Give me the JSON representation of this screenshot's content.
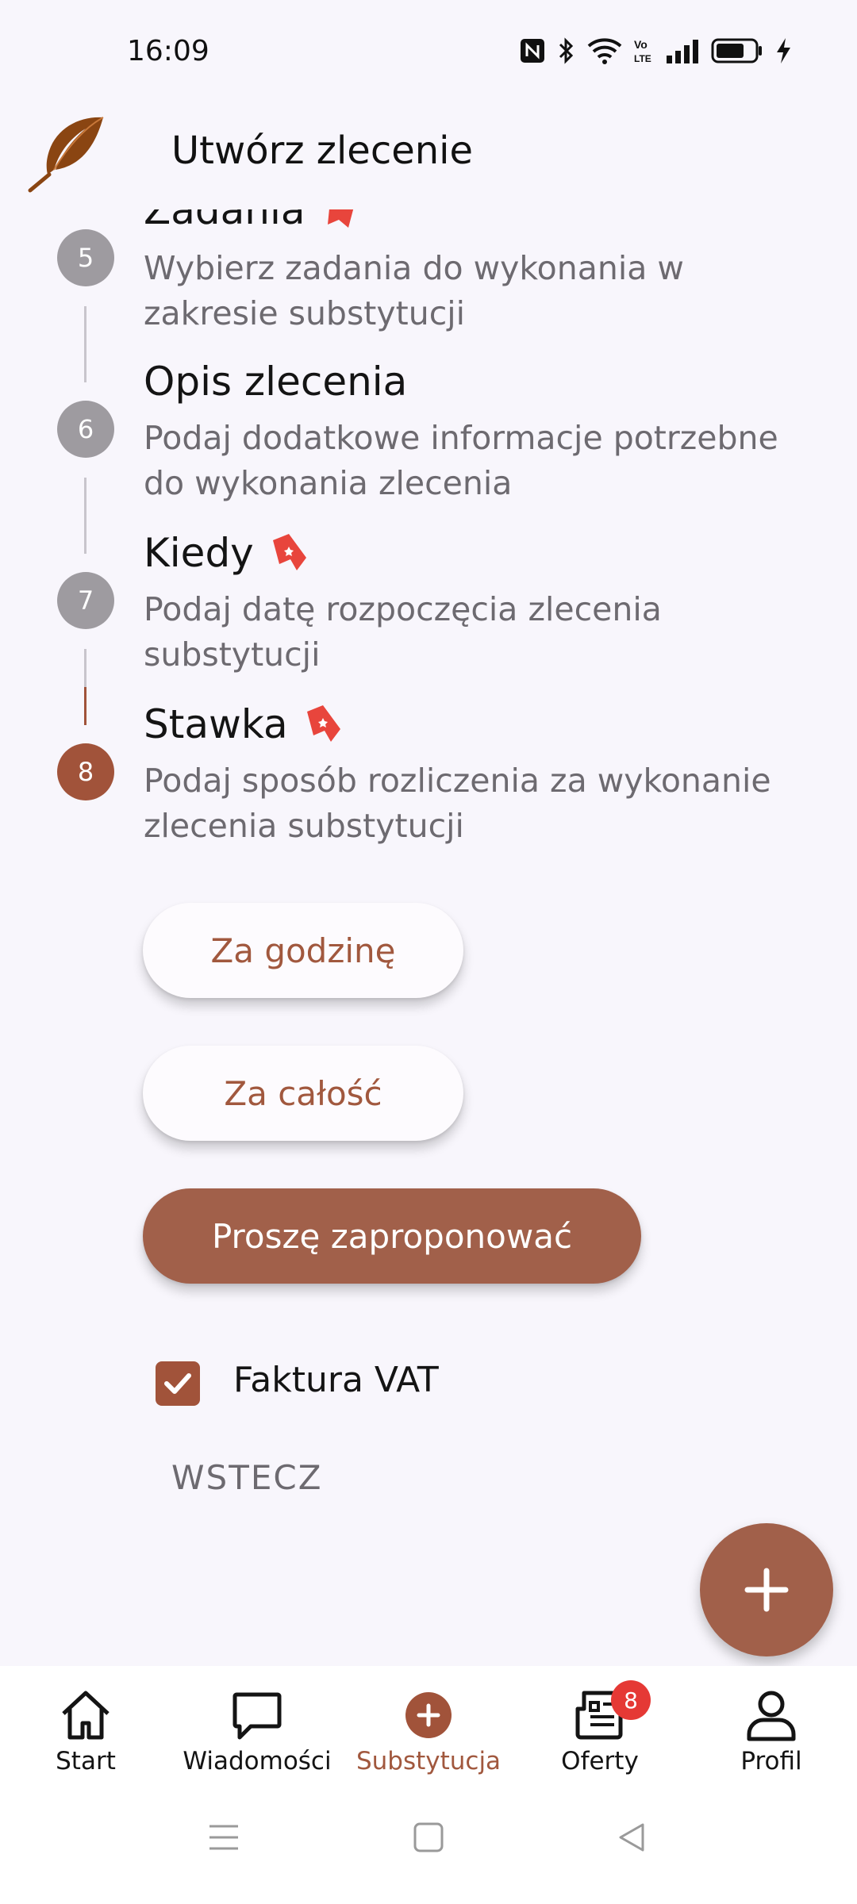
{
  "status_bar": {
    "time": "16:09",
    "icons": [
      "nfc-icon",
      "bluetooth-icon",
      "wifi-icon",
      "volte-icon",
      "signal-icon",
      "battery-icon",
      "charging-icon"
    ]
  },
  "app_bar": {
    "title": "Utwórz zlecenie",
    "logo": "feather-icon"
  },
  "steps": [
    {
      "number": "5",
      "title": "Zadania",
      "description": "Wybierz zadania do wykonania w zakresie substytucji",
      "required": true
    },
    {
      "number": "6",
      "title": "Opis zlecenia",
      "description": "Podaj dodatkowe informacje potrzebne do wykonania zlecenia",
      "required": false
    },
    {
      "number": "7",
      "title": "Kiedy",
      "description": "Podaj datę rozpoczęcia zlecenia substytucji",
      "required": true
    },
    {
      "number": "8",
      "title": "Stawka",
      "description": "Podaj sposób rozliczenia za wykonanie zlecenia substytucji",
      "required": true,
      "active": true
    }
  ],
  "rate_options": {
    "hourly": "Za godzinę",
    "total": "Za całość",
    "propose": "Proszę zaproponować",
    "selected": "Proszę zaproponować"
  },
  "vat_checkbox": {
    "label": "Faktura VAT",
    "checked": true
  },
  "back_button": "WSTECZ",
  "fab": {
    "icon": "plus-icon"
  },
  "bottom_nav": {
    "items": [
      {
        "label": "Start",
        "icon": "home-icon"
      },
      {
        "label": "Wiadomości",
        "icon": "chat-icon"
      },
      {
        "label": "Substytucja",
        "icon": "add-circle-icon",
        "active": true
      },
      {
        "label": "Oferty",
        "icon": "newspaper-icon",
        "badge": "8"
      },
      {
        "label": "Profil",
        "icon": "person-icon"
      }
    ]
  },
  "colors": {
    "accent": "#a1533a",
    "accent_light": "#a1604a",
    "background": "#f8f6fc",
    "inactive_step": "#9e9ba0",
    "badge": "#e53935"
  }
}
